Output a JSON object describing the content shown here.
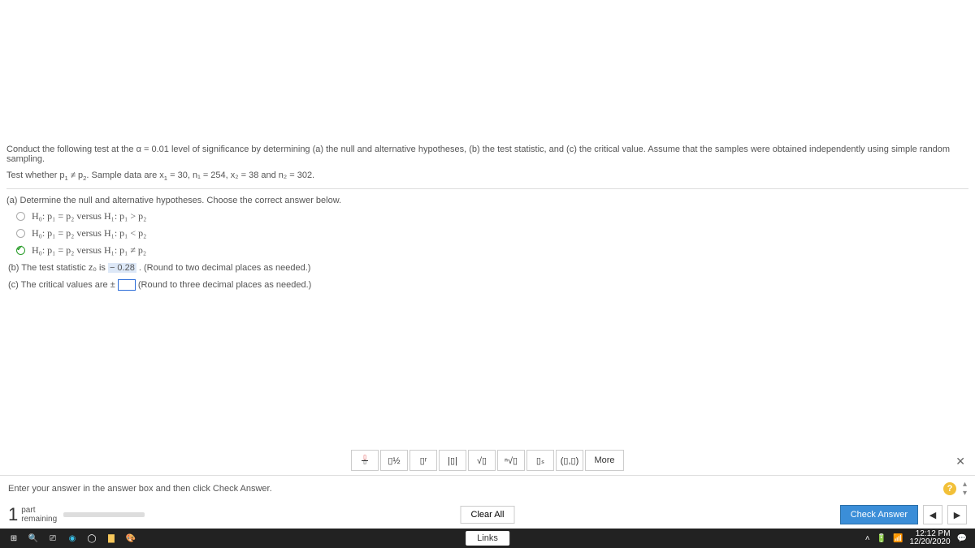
{
  "problem": {
    "line1_a": "Conduct the following test at the α = 0.01 level of significance by determining (a) the null and alternative hypotheses, (b) the test statistic, and (c) the critical value. Assume that the samples were obtained independently using simple random sampling.",
    "line2_pre": "Test whether p",
    "line2_mid": " ≠ p",
    "line2_post": ". Sample data are x",
    "line2_vals": " = 30, n₁ = 254, x₂ = 38 and n₂ = 302."
  },
  "partA": {
    "prompt": "(a) Determine the null and alternative hypotheses. Choose the correct answer below.",
    "opt1_h0": "H₀: p₁ = p₂ versus H₁: p₁ > p₂",
    "opt2_h0": "H₀: p₁ = p₂ versus H₁: p₁ < p₂",
    "opt3_h0": "H₀: p₁ = p₂ versus H₁: p₁ ≠ p₂",
    "selected_index": 2
  },
  "partB": {
    "pre": "(b) The test statistic z₀ is ",
    "value": "− 0.28",
    "post": " . (Round to two decimal places as needed.)"
  },
  "partC": {
    "pre": "(c) The critical values are ± ",
    "post": " (Round to three decimal places as needed.)"
  },
  "palette": {
    "btn_frac": "▯/▯",
    "btn_mixed": "▯½",
    "btn_exp": "▯ʳ",
    "btn_abs": "|▯|",
    "btn_sqrt": "√▯",
    "btn_nthroot": "ⁿ√▯",
    "btn_sub": "▯ₛ",
    "btn_pair": "(▯,▯)",
    "btn_more": "More"
  },
  "instr": "Enter your answer in the answer box and then click Check Answer.",
  "progress": {
    "count": "1",
    "labelA": "part",
    "labelB": "remaining"
  },
  "buttons": {
    "clear": "Clear All",
    "check": "Check Answer",
    "links": "Links"
  },
  "taskbar": {
    "time": "12:12 PM",
    "date": "12/20/2020"
  }
}
